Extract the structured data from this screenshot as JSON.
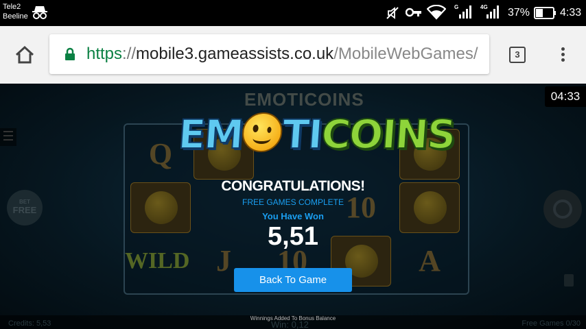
{
  "status_bar": {
    "carrier_1": "Tele2",
    "carrier_2": "Beeline",
    "net_1": "G",
    "net_2": "4G",
    "battery_percent": "37%",
    "time": "4:33",
    "icons": [
      "incognito-icon",
      "mute-icon",
      "vpn-key-icon",
      "wifi-icon",
      "signal-icon",
      "signal-icon",
      "battery-icon"
    ]
  },
  "browser": {
    "url_scheme": "https",
    "url_separator": "://",
    "url_host": "mobile3.gameassists.co.uk",
    "url_path": "/MobileWebGames/",
    "tab_count": "3",
    "icons": [
      "home-icon",
      "lock-icon",
      "overflow-menu-icon"
    ],
    "colors": {
      "secure_green": "#0b8043",
      "toolbar_bg": "#f2f2f2"
    }
  },
  "game": {
    "background_logo": "EMOTICOINS",
    "timer": "04:33",
    "bet_label": "BET",
    "bet_mode": "FREE",
    "reel_symbols": [
      "Q",
      "10",
      "J",
      "10",
      "A",
      "WILD"
    ],
    "bottom": {
      "credits": "Credits: 5,53",
      "winnings_note": "Winnings Added To Bonus Balance",
      "win": "Win: 0,12",
      "free_games": "Free Games 0/30"
    }
  },
  "popup": {
    "logo_left": "EM",
    "logo_right_1": "TI",
    "logo_right_2": "COINS",
    "congrats": "CONGRATULATIONS!",
    "subtitle": "FREE GAMES COMPLETE",
    "won_label": "You Have Won",
    "amount": "5,51",
    "button_label": "Back To Game",
    "colors": {
      "accent_blue": "#1791ea",
      "label_blue": "#1a9ff2"
    }
  }
}
